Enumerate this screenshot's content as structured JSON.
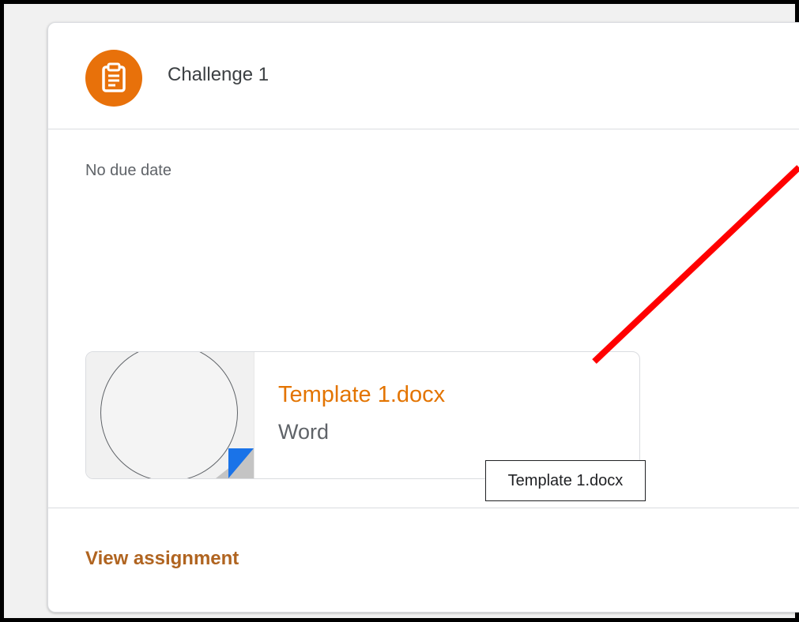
{
  "assignment": {
    "title": "Challenge 1",
    "icon": "assignment-icon",
    "due": "No due date"
  },
  "attachment": {
    "name": "Template 1.docx",
    "type": "Word",
    "tooltip": "Template 1.docx"
  },
  "footer": {
    "view_label": "View assignment"
  },
  "colors": {
    "accent": "#e8710a",
    "link": "#b06420",
    "annotation": "#ff0000",
    "file_corner": "#1a73e8"
  }
}
